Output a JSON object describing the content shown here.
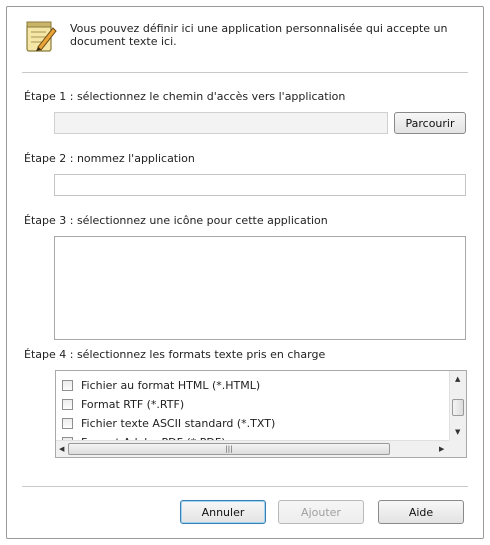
{
  "intro": {
    "line1": "Vous pouvez définir ici une application personnalisée qui accepte un",
    "line2": "document texte ici."
  },
  "step1": {
    "label": "Étape 1 : sélectionnez le chemin d'accès vers l'application",
    "path_value": "",
    "browse_label": "Parcourir"
  },
  "step2": {
    "label": "Étape 2 : nommez l'application",
    "name_value": ""
  },
  "step3": {
    "label": "Étape 3 : sélectionnez une icône pour cette application"
  },
  "step4": {
    "label": "Étape 4 : sélectionnez les formats texte pris en charge",
    "formats": [
      {
        "label": "Fichier au format HTML (*.HTML)",
        "checked": false
      },
      {
        "label": "Format RTF (*.RTF)",
        "checked": false
      },
      {
        "label": "Fichier texte ASCII standard (*.TXT)",
        "checked": false
      },
      {
        "label": "Format Adobe PDF (*.PDF)",
        "checked": false
      }
    ]
  },
  "buttons": {
    "cancel": "Annuler",
    "add": "Ajouter",
    "help": "Aide"
  },
  "icons": {
    "header": "notepad-pencil-icon"
  }
}
